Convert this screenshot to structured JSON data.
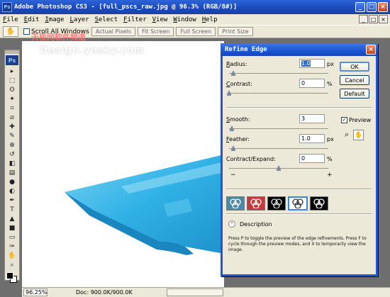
{
  "window": {
    "app_icon": "Ps",
    "title": "Adobe Photoshop CS3 - [full_pscs_raw.jpg @ 96.3% (RGB/8#)]",
    "controls": [
      "_",
      "□",
      "×"
    ]
  },
  "menu": {
    "items": [
      {
        "key": "F",
        "rest": "ile"
      },
      {
        "key": "E",
        "rest": "dit"
      },
      {
        "key": "I",
        "rest": "mage"
      },
      {
        "key": "L",
        "rest": "ayer"
      },
      {
        "key": "S",
        "rest": "elect"
      },
      {
        "key": "F",
        "rest": "ilter"
      },
      {
        "key": "V",
        "rest": "iew"
      },
      {
        "key": "W",
        "rest": "indow"
      },
      {
        "key": "H",
        "rest": "elp"
      }
    ],
    "doc_controls": [
      "_",
      "□",
      "×"
    ]
  },
  "options_bar": {
    "scroll_all_windows_label": "Scroll All Windows",
    "actual_pixels": "Actual Pixels",
    "fit_screen": "Fit Screen",
    "full_screen": "Full Screen",
    "print_size": "Print Size"
  },
  "watermark": {
    "line1": "天极网软件频道",
    "line2": "Design.yesky.com"
  },
  "tools_panel": {
    "logo": "Ps",
    "icons": [
      "move-icon",
      "marquee-icon",
      "lasso-icon",
      "magic-wand-icon",
      "crop-icon",
      "slice-icon",
      "healing-brush-icon",
      "brush-icon",
      "clone-stamp-icon",
      "history-brush-icon",
      "eraser-icon",
      "gradient-icon",
      "blur-icon",
      "dodge-icon",
      "pen-icon",
      "type-icon",
      "path-selection-icon",
      "shape-icon",
      "notes-icon",
      "eyedropper-icon",
      "hand-icon",
      "zoom-icon"
    ],
    "glyphs": [
      "▸",
      "⬚",
      "ʘ",
      "✦",
      "⌗",
      "⧄",
      "✚",
      "✎",
      "⊕",
      "↺",
      "◧",
      "▤",
      "●",
      "◐",
      "✒",
      "T",
      "▲",
      "■",
      "▭",
      "✑",
      "✋",
      "⌕"
    ]
  },
  "status_bar": {
    "zoom": "96.25%",
    "doc": "Doc: 900.0K/900.0K"
  },
  "refine_edge": {
    "title": "Refine Edge",
    "close": "×",
    "params": [
      {
        "id": "radius",
        "key": "R",
        "rest": "adius:",
        "value": "1.0",
        "unit": "px",
        "selected": true,
        "slider": 0.04
      },
      {
        "id": "contrast",
        "key": "C",
        "rest": "ontrast:",
        "value": "0",
        "unit": "%",
        "selected": false,
        "slider": 0.0
      },
      {
        "id": "smooth",
        "key": "S",
        "rest": "mooth:",
        "value": "3",
        "unit": "",
        "selected": false,
        "slider": 0.03
      },
      {
        "id": "feather",
        "key": "F",
        "rest": "eather:",
        "value": "1.0",
        "unit": "px",
        "selected": false,
        "slider": 0.04
      },
      {
        "id": "contract-expand",
        "key": "",
        "rest": "Contract/Expand:",
        "value": "0",
        "unit": "%",
        "selected": false,
        "slider": 0.5
      }
    ],
    "minus": "−",
    "plus": "+",
    "buttons": {
      "ok": "OK",
      "cancel": "Cancel",
      "default": "Default"
    },
    "preview_label": "Preview",
    "preview_checked": "✓",
    "zoom_icon": "⌕",
    "hand_icon": "✋",
    "preview_modes": [
      "standard",
      "quick-mask",
      "on-black",
      "on-white",
      "mask"
    ],
    "description_label": "Description",
    "description_toggle": "⌃",
    "help_text": "Press P to toggle the preview of the edge refinements. Press F to cycle through the preview modes, and X to temporarily view the image."
  },
  "colors": {
    "title_blue": "#1c55cf",
    "chrome": "#ece9d8",
    "object_blue": "#35b6e8"
  }
}
